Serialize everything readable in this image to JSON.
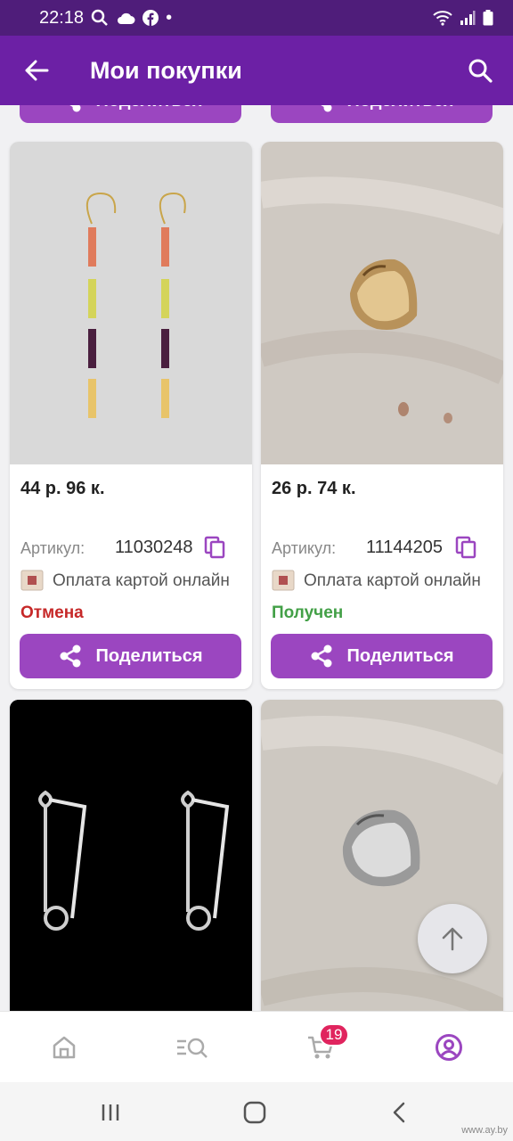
{
  "status_bar": {
    "time": "22:18",
    "dot": "•",
    "icons": [
      "search-icon",
      "cloud-icon",
      "facebook-icon",
      "wifi-icon",
      "signal-icon",
      "battery-icon"
    ]
  },
  "app_bar": {
    "title": "Мои покупки"
  },
  "share_label": "Поделиться",
  "products": [
    {
      "price": "44 р. 96 к.",
      "article_label": "Артикул:",
      "article": "11030248",
      "payment": "Оплата картой онлайн",
      "status": "Отмена",
      "status_color": "#c62828"
    },
    {
      "price": "26 р. 74 к.",
      "article_label": "Артикул:",
      "article": "11144205",
      "payment": "Оплата картой онлайн",
      "status": "Получен",
      "status_color": "#43a047"
    }
  ],
  "cart_badge": "19",
  "watermark": "www.ay.by",
  "colors": {
    "primary": "#6c20a5",
    "status_bar": "#4f1d7a",
    "button": "#9b46c0"
  }
}
